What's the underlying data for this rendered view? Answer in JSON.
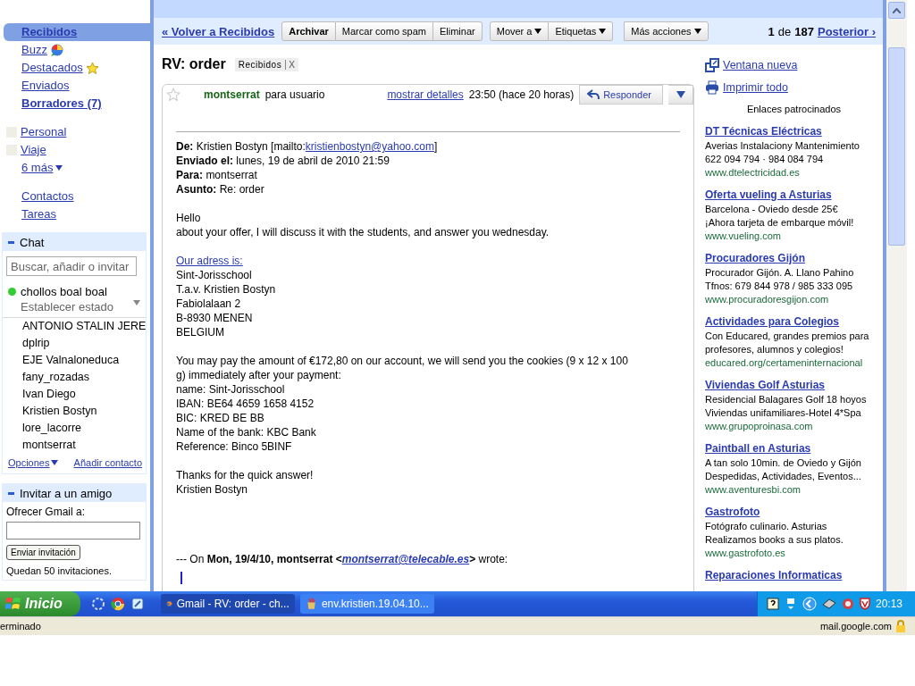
{
  "nav": [
    {
      "label": "Recibidos",
      "selected": true,
      "bold": true
    },
    {
      "label": "Buzz",
      "selected": false,
      "bold": false
    },
    {
      "label": "Destacados",
      "selected": false,
      "bold": false
    },
    {
      "label": "Enviados",
      "selected": false,
      "bold": false
    },
    {
      "label": "Borradores (7)",
      "selected": false,
      "bold": true
    }
  ],
  "labels": [
    "Personal",
    "Viaje"
  ],
  "more_labels": "6 más",
  "links": [
    "Contactos",
    "Tareas"
  ],
  "chat": {
    "title": "Chat",
    "placeholder": "Buscar, añadir o invitar",
    "me": "chollos boal boal",
    "status": "Establecer estado",
    "contacts": [
      "ANTONIO STALIN JERE",
      "dplrip",
      "EJE Valnaloneduca",
      "fany_rozadas",
      "Ivan Diego",
      "Kristien Bostyn",
      "lore_lacorre",
      "montserrat"
    ],
    "options": "Opciones",
    "add": "Añadir contacto"
  },
  "invite": {
    "title": "Invitar a un amigo",
    "label": "Ofrecer Gmail a:",
    "button": "Enviar invitación",
    "note": "Quedan 50 invitaciones."
  },
  "toolbar": {
    "back": "« Volver a Recibidos",
    "groups": [
      [
        {
          "label": "Archivar",
          "bold": true,
          "dropdown": false
        },
        {
          "label": "Marcar como spam",
          "bold": false,
          "dropdown": false
        },
        {
          "label": "Eliminar",
          "bold": false,
          "dropdown": false
        }
      ],
      [
        {
          "label": "Mover a",
          "bold": false,
          "dropdown": true
        },
        {
          "label": "Etiquetas",
          "bold": false,
          "dropdown": true
        }
      ],
      [
        {
          "label": "Más acciones",
          "bold": false,
          "dropdown": true
        }
      ]
    ],
    "current": "1",
    "of": "de",
    "total": "187",
    "next": "Posterior ›"
  },
  "message": {
    "subject": "RV: order",
    "label": "Recibidos",
    "label_close": "X",
    "starred": false,
    "sender": "montserrat",
    "recipient": "para usuario",
    "details": "mostrar detalles",
    "time": "23:50 (hace 20 horas)",
    "reply": "Responder",
    "headers": [
      {
        "key": "De:",
        "value": "Kristien Bostyn [mailto:",
        "link": "kristienbostyn@yahoo.com",
        "tail": "]"
      },
      {
        "key": "Enviado el:",
        "value": "lunes, 19 de abril de 2010 21:59"
      },
      {
        "key": "Para:",
        "value": "montserrat"
      },
      {
        "key": "Asunto:",
        "value": "Re: order"
      }
    ],
    "body": [
      [
        {
          "kind": "text",
          "text": "Hello"
        },
        {
          "kind": "text",
          "text": "about your offer, I will discuss it with the students, and answer you wednesday."
        }
      ],
      [
        {
          "kind": "link",
          "text": "Our adress is:"
        },
        {
          "kind": "text",
          "text": "Sint-Jorisschool"
        },
        {
          "kind": "text",
          "text": "T.a.v. Kristien Bostyn"
        },
        {
          "kind": "text",
          "text": "Fabiolalaan 2"
        },
        {
          "kind": "text",
          "text": "B-8930 MENEN"
        },
        {
          "kind": "text",
          "text": "BELGIUM"
        }
      ],
      [
        {
          "kind": "text",
          "text": "You may pay the amount of €172,80 on our account, we will send you the cookies (9 x 12 x 100"
        },
        {
          "kind": "text",
          "text": "g) immediately after your payment:"
        },
        {
          "kind": "text",
          "text": "name: Sint-Jorisschool"
        },
        {
          "kind": "text",
          "text": "IBAN: BE64 4659 1658 4152"
        },
        {
          "kind": "text",
          "text": "BIC: KRED BE BB"
        },
        {
          "kind": "text",
          "text": "Name of the bank: KBC Bank"
        },
        {
          "kind": "text",
          "text": "Reference: Binco 5BINF"
        }
      ],
      [
        {
          "kind": "text",
          "text": "Thanks for the quick answer!"
        },
        {
          "kind": "text",
          "text": "Kristien Bostyn"
        }
      ]
    ],
    "quote": {
      "before": "--- On **Mon, 19/4/10, montserrat <**",
      "link": "montserrat@telecable.es",
      "after": "**>** wrote:"
    }
  },
  "side": {
    "actions": [
      "Ventana nueva",
      "Imprimir todo"
    ],
    "ads_title": "Enlaces patrocinados",
    "ads": [
      {
        "title": "DT Técnicas Eléctricas",
        "lines": [
          "Averias Instalaciony Mantenimiento",
          "622 094 794 · 984 084 794"
        ],
        "url": "www.dtelectricidad.es"
      },
      {
        "title": "Oferta vueling a Asturias",
        "lines": [
          "Barcelona - Oviedo desde 25€",
          "¡Ahora tarjeta de embarque móvil!"
        ],
        "url": "www.vueling.com"
      },
      {
        "title": "Procuradores Gijón",
        "lines": [
          "Procurador Gijón. A. Llano Pahino",
          "Tfnos: 679 844 978 / 985 333 095"
        ],
        "url": "www.procuradoresgijon.com"
      },
      {
        "title": "Actividades para Colegios",
        "lines": [
          "Con Educared, grandes premios para",
          "profesores, alumnos y colegios!"
        ],
        "url": "educared.org/certameninternacional"
      },
      {
        "title": "Viviendas Golf Asturias",
        "lines": [
          "Residencial Balagares Golf 18 hoyos",
          "Viviendas unifamiliares-Hotel 4*Spa"
        ],
        "url": "www.grupoproinasa.com"
      },
      {
        "title": "Paintball en Asturias",
        "lines": [
          "A tan solo 10min. de Oviedo y Gijón",
          "Despedidas, Actividades, Eventos..."
        ],
        "url": "www.aventuresbi.com"
      },
      {
        "title": "Gastrofoto",
        "lines": [
          "Fotógrafo culinario. Asturias",
          "Realizamos books a sus platos."
        ],
        "url": "www.gastrofoto.es"
      },
      {
        "title": "Reparaciones Informaticas"
      }
    ]
  },
  "taskbar": {
    "start": "Inicio",
    "tasks": [
      {
        "label": "Gmail - RV: order - ch...",
        "selected": true
      },
      {
        "label": "env.kristien.19.04.10...",
        "selected": false
      }
    ],
    "clock": "20:13"
  },
  "status_bar": {
    "text": "erminado",
    "host": "mail.google.com"
  }
}
